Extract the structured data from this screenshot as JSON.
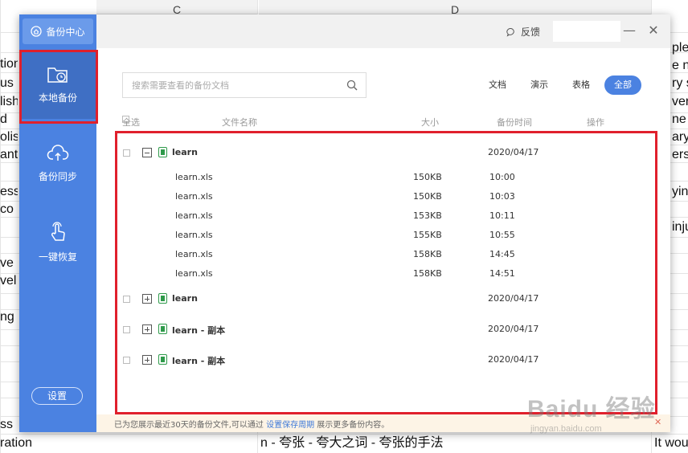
{
  "spreadsheet": {
    "col_headers": [
      "C",
      "D"
    ],
    "left_cells": [
      "tion",
      "us",
      "lish",
      "d",
      "olish",
      "ant",
      "ess",
      "co",
      "ve",
      "vel",
      "ng",
      "ss",
      "ration"
    ],
    "right_cells": [
      "ple",
      "e na",
      "ry s",
      "ver",
      "ne",
      "ary",
      "ers",
      "yin",
      "inju",
      "It wou"
    ],
    "bottom_text": "n - 夸张 - 夸大之词 - 夸张的手法"
  },
  "dialog": {
    "brand_label": "备份中心",
    "nav": [
      {
        "label": "本地备份",
        "icon": "folder-clock-icon"
      },
      {
        "label": "备份同步",
        "icon": "cloud-upload-icon"
      },
      {
        "label": "一键恢复",
        "icon": "hand-touch-icon"
      }
    ],
    "settings_label": "设置",
    "feedback_label": "反馈",
    "min_symbol": "—",
    "close_symbol": "✕",
    "search_placeholder": "搜索需要查看的备份文档",
    "filters": [
      "文档",
      "演示",
      "表格",
      "全部"
    ],
    "active_filter": "全部",
    "table_headers": {
      "select_all": "全选",
      "name": "文件名称",
      "size": "大小",
      "time": "备份时间",
      "action": "操作"
    },
    "groups": [
      {
        "name": "learn",
        "date": "2020/04/17",
        "expanded": true
      },
      {
        "name": "learn",
        "date": "2020/04/17",
        "expanded": false
      },
      {
        "name": "learn - 副本",
        "date": "2020/04/17",
        "expanded": false
      },
      {
        "name": "learn - 副本",
        "date": "2020/04/17",
        "expanded": false
      }
    ],
    "files": [
      {
        "name": "learn.xls",
        "size": "150KB",
        "time": "10:00"
      },
      {
        "name": "learn.xls",
        "size": "150KB",
        "time": "10:03"
      },
      {
        "name": "learn.xls",
        "size": "153KB",
        "time": "10:11"
      },
      {
        "name": "learn.xls",
        "size": "155KB",
        "time": "10:55"
      },
      {
        "name": "learn.xls",
        "size": "158KB",
        "time": "14:45"
      },
      {
        "name": "learn.xls",
        "size": "158KB",
        "time": "14:51"
      }
    ],
    "hint_prefix": "已为您展示最近30天的备份文件,可以通过 ",
    "hint_link": "设置保存周期",
    "hint_suffix": " 展示更多备份内容。",
    "hint_close": "✕"
  },
  "watermark": {
    "main": "Baidu 经验",
    "sub": "jingyan.baidu.com"
  },
  "colors": {
    "sidebar": "#4b82e1",
    "sidebar_active": "#3f6fc4",
    "accent": "#4b82e1",
    "highlight": "#e0202c",
    "xls_green": "#2e9a4a"
  }
}
